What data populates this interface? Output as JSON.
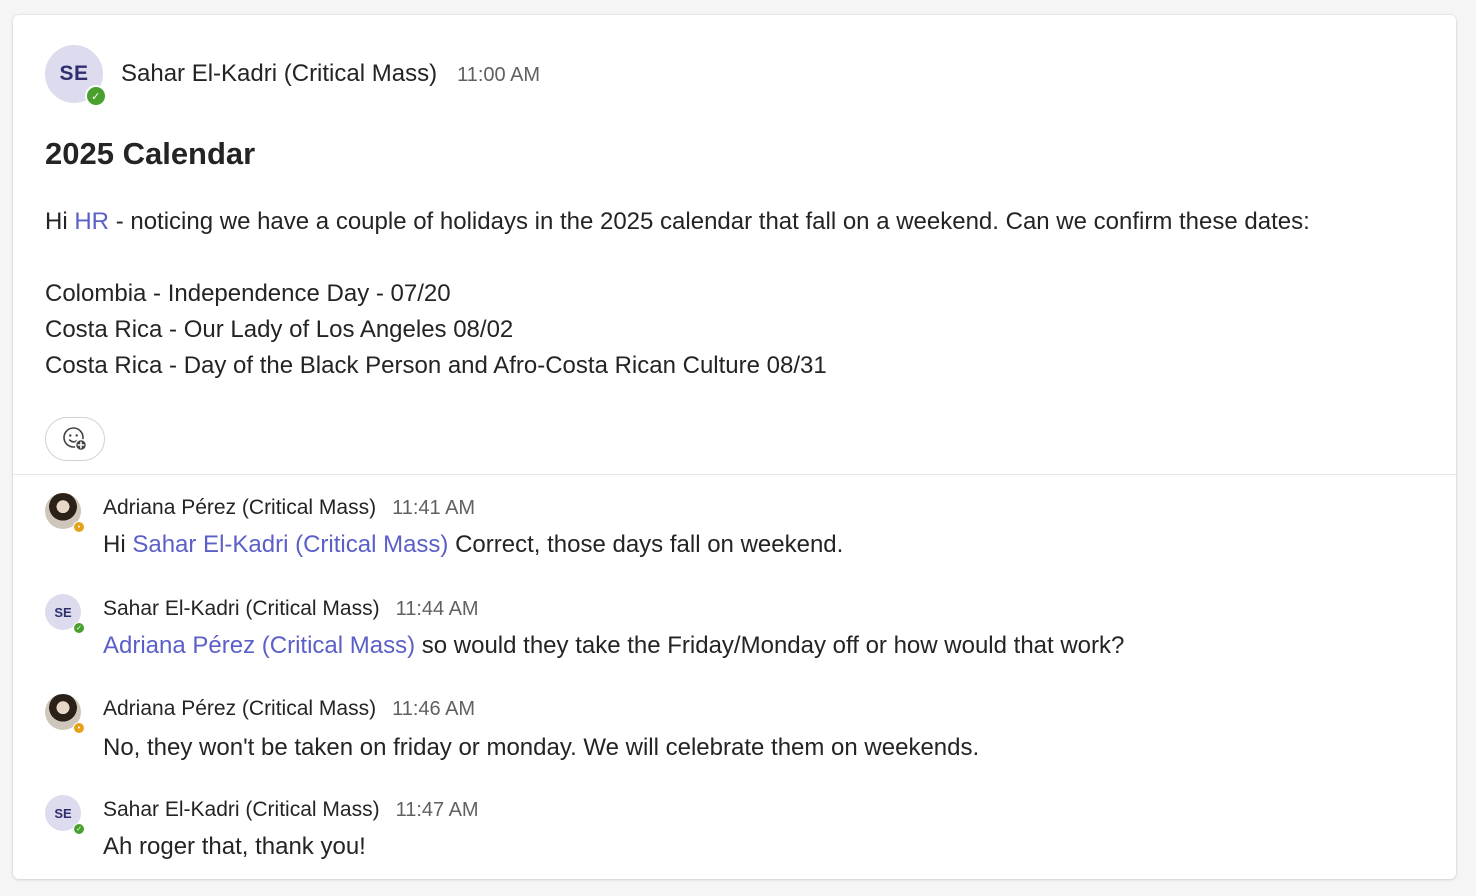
{
  "root": {
    "author_initials": "SE",
    "author": "Sahar El-Kadri (Critical Mass)",
    "time": "11:00 AM",
    "subject": "2025 Calendar",
    "greeting": "Hi",
    "mention": "HR",
    "intro": "- noticing we have a couple of holidays in the 2025 calendar that fall on a weekend. Can we confirm these dates:",
    "holidays": [
      "Colombia - Independence Day - 07/20",
      "Costa Rica - Our Lady of Los Angeles 08/02",
      "Costa Rica - Day of the Black Person and Afro-Costa Rican Culture 08/31"
    ],
    "presence": "available"
  },
  "replies": [
    {
      "author": "Adriana Pérez (Critical Mass)",
      "time": "11:41 AM",
      "avatar": "photo",
      "presence": "away",
      "prefix": "Hi",
      "mention": "Sahar El-Kadri (Critical Mass)",
      "text": "Correct,  those days fall on weekend."
    },
    {
      "author": "Sahar El-Kadri (Critical Mass)",
      "time": "11:44 AM",
      "avatar": "SE",
      "presence": "available",
      "mention": "Adriana Pérez (Critical Mass)",
      "text": "so would they take the Friday/Monday off or how would that work?"
    },
    {
      "author": "Adriana Pérez (Critical Mass)",
      "time": "11:46 AM",
      "avatar": "photo",
      "presence": "away",
      "text": "No, they won't be taken on friday or monday. We will celebrate them on weekends."
    },
    {
      "author": "Sahar El-Kadri (Critical Mass)",
      "time": "11:47 AM",
      "avatar": "SE",
      "presence": "available",
      "text": "Ah roger that, thank you!"
    }
  ],
  "colors": {
    "mention": "#5b5fc7",
    "available": "#4aa02c",
    "away": "#e3a21a"
  },
  "icons": {
    "add_reaction": "emoji-add-icon",
    "available": "check-icon",
    "away": "clock-icon"
  }
}
